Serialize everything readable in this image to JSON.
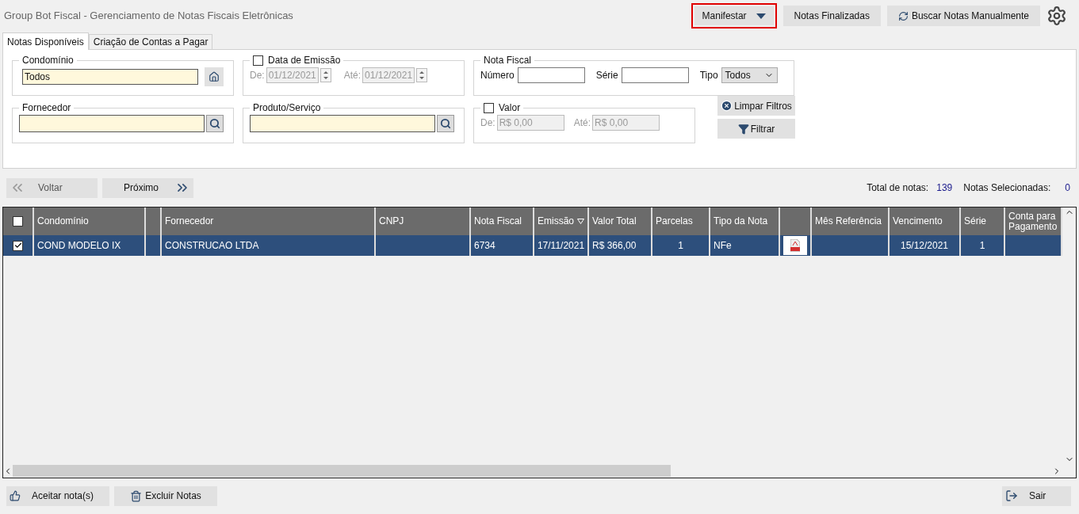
{
  "window": {
    "title": "Group Bot Fiscal - Gerenciamento de Notas Fiscais Eletrônicas"
  },
  "toolbar": [
    {
      "label": "Manifestar",
      "kind": "dropdown",
      "highlighted": true
    },
    {
      "label": "Notas Finalizadas",
      "kind": "plain",
      "highlighted": false
    },
    {
      "label": "Buscar Notas Manualmente",
      "kind": "refresh",
      "highlighted": false
    }
  ],
  "tabs": [
    {
      "label": "Notas Disponíveis",
      "selected": true
    },
    {
      "label": "Criação de Contas a Pagar",
      "selected": false
    }
  ],
  "filters": {
    "condominio": {
      "label": "Condomínio",
      "value": "Todos"
    },
    "data_emissao": {
      "label": "Data de Emissão",
      "checked": false,
      "from_label": "De:",
      "from": "01/12/2021",
      "to_label": "Até:",
      "to": "01/12/2021"
    },
    "nota_fiscal": {
      "label": "Nota Fiscal",
      "numero_label": "Número",
      "serie_label": "Série",
      "tipo_label": "Tipo",
      "tipo": "Todos"
    },
    "fornecedor": {
      "label": "Fornecedor"
    },
    "produto": {
      "label": "Produto/Serviço"
    },
    "valor": {
      "label": "Valor",
      "checked": false,
      "from_label": "De:",
      "from": "R$ 0,00",
      "to_label": "Até:",
      "to": "R$ 0,00"
    },
    "clear_button": "Limpar Filtros",
    "filter_button": "Filtrar"
  },
  "pager": {
    "back": "Voltar",
    "next": "Próximo",
    "total_label": "Total de notas:",
    "total": "139",
    "selected_label": "Notas Selecionadas:",
    "selected": "0"
  },
  "grid": {
    "header_checked": false,
    "columns": [
      {
        "kind": "check"
      },
      {
        "kind": "text",
        "label": "Condomínio"
      },
      {
        "kind": "blank"
      },
      {
        "kind": "text",
        "label": "Fornecedor"
      },
      {
        "kind": "text",
        "label": "CNPJ"
      },
      {
        "kind": "text",
        "label": "Nota Fiscal"
      },
      {
        "kind": "sort",
        "label": "Emissão"
      },
      {
        "kind": "text",
        "label": "Valor Total"
      },
      {
        "kind": "text",
        "label": "Parcelas"
      },
      {
        "kind": "text",
        "label": "Tipo da Nota"
      },
      {
        "kind": "pdf"
      },
      {
        "kind": "text",
        "label": "Mês Referência"
      },
      {
        "kind": "text",
        "label": "Vencimento"
      },
      {
        "kind": "text",
        "label": "Série"
      },
      {
        "kind": "text",
        "label": "Conta para Pagamento"
      }
    ],
    "rows": [
      {
        "selected": true,
        "checked": true,
        "condominio": "COND MODELO IX",
        "fornecedor": "CONSTRUCAO LTDA",
        "nota_fiscal": "6734",
        "emissao": "17/11/2021",
        "valor_total": "R$ 366,00",
        "parcelas": "1",
        "tipo": "NFe",
        "pdf": true,
        "vencimento": "15/12/2021",
        "serie": "1"
      }
    ]
  },
  "footer": {
    "accept": "Aceitar nota(s)",
    "delete": "Excluir Notas",
    "exit": "Sair"
  }
}
